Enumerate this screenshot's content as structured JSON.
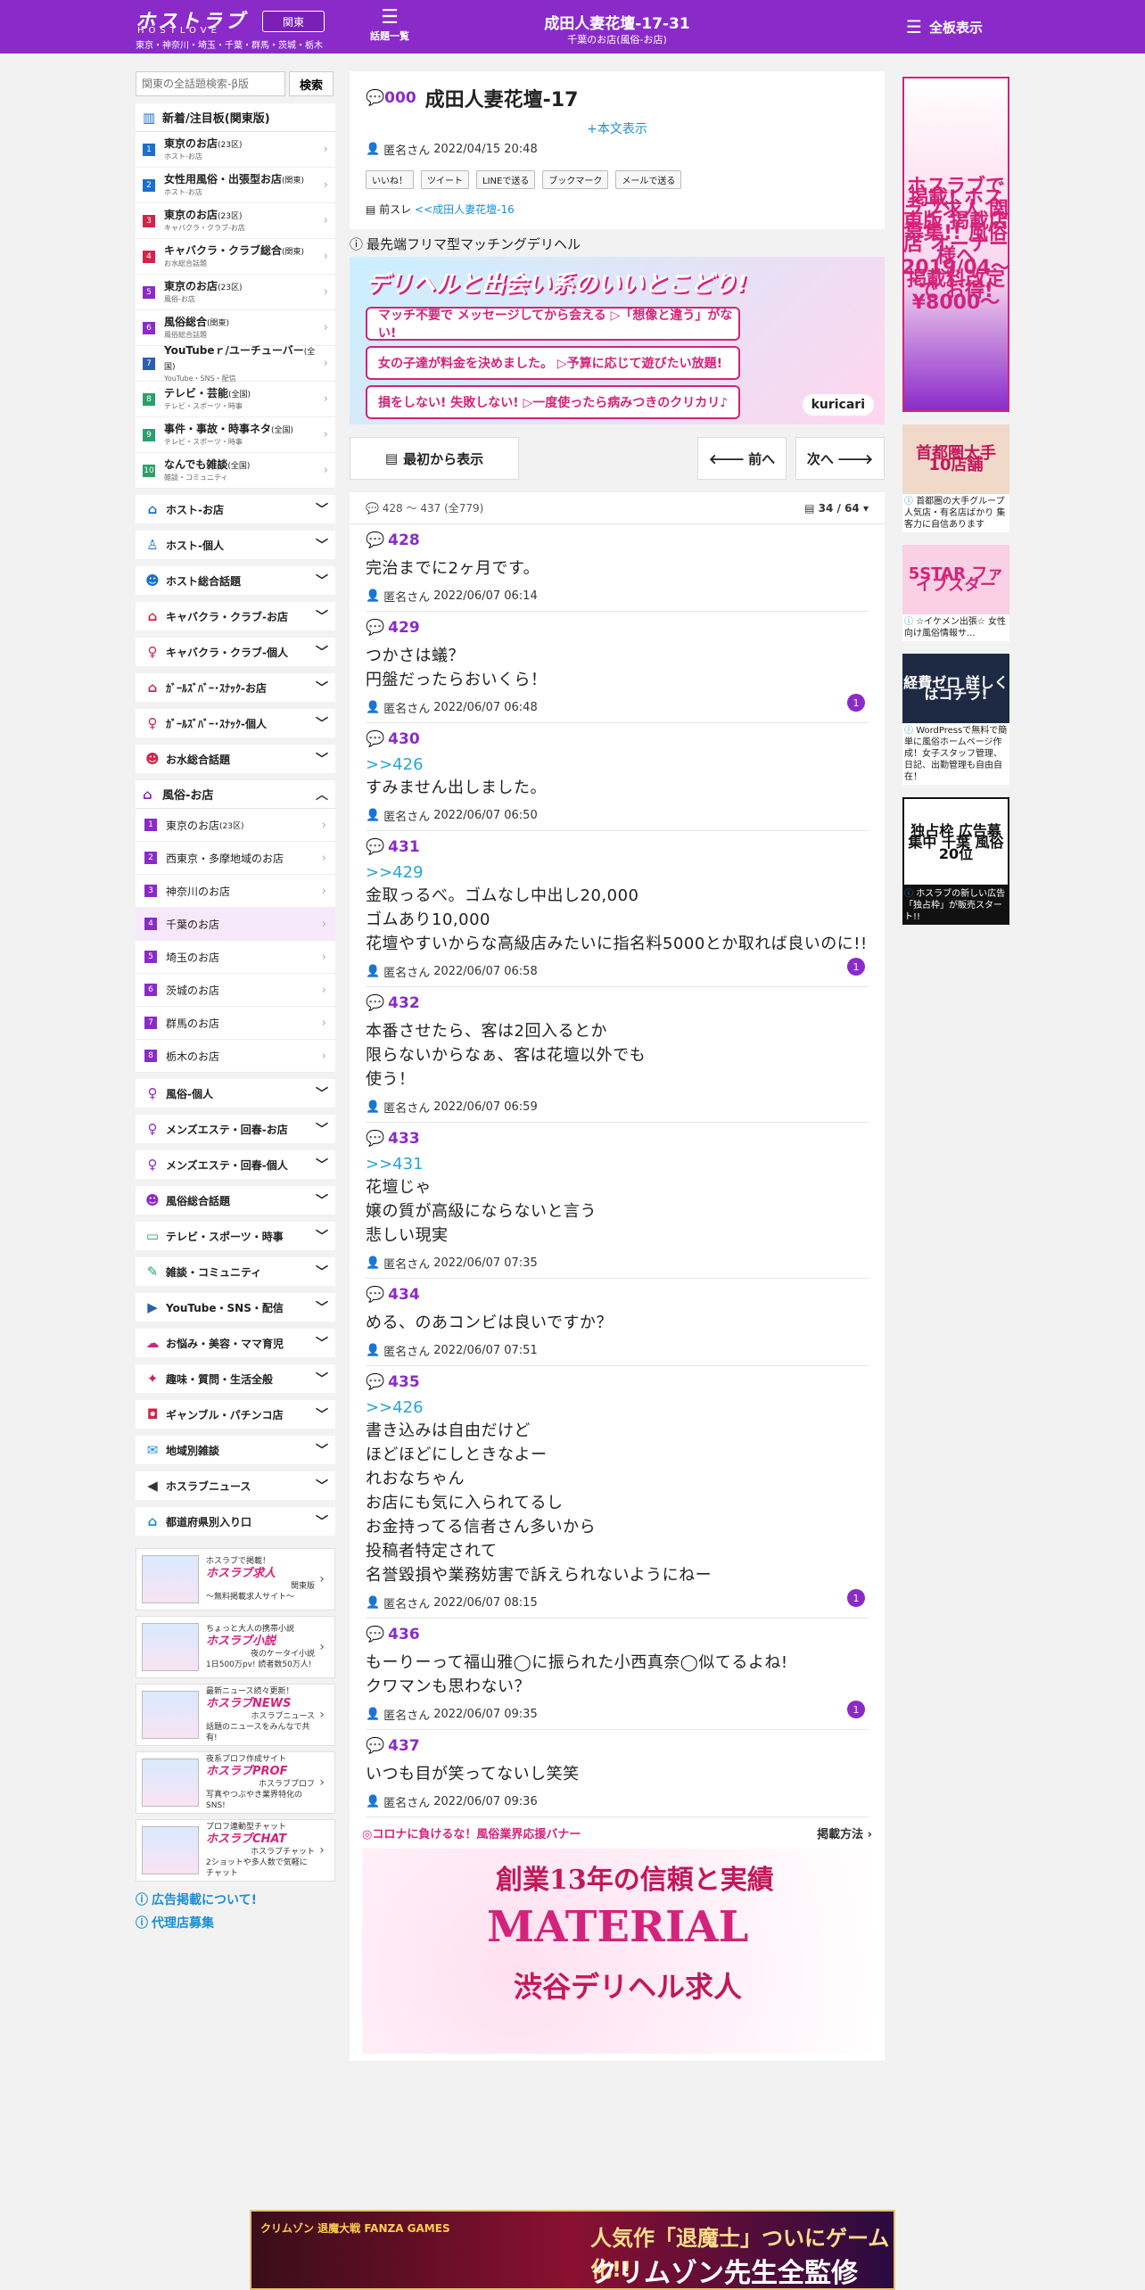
{
  "header": {
    "logo": "ホストラブ",
    "logo_sub": "HOSTLOVE",
    "region_button": "関東",
    "region_list": "東京・神奈川・埼玉・千葉・群馬・茨城・栃木",
    "topics_glyph": "☰",
    "topics_label": "話題一覧",
    "title": "成田人妻花壇-17-31",
    "subtitle": "千葉のお店(風俗-お店)",
    "board_label": "全板表示"
  },
  "sidebar": {
    "search_placeholder": "関東の全話題検索-β版",
    "search_button": "検索",
    "new_title": "新着/注目板(関東版)",
    "new_items": [
      {
        "n": "1",
        "color": "#1a6fd0",
        "title": "東京のお店",
        "tag": "(23区)",
        "sub": "ホスト-お店"
      },
      {
        "n": "2",
        "color": "#1a6fd0",
        "title": "女性用風俗・出張型お店",
        "tag": "(関東)",
        "sub": "ホスト-お店"
      },
      {
        "n": "3",
        "color": "#d4234a",
        "title": "東京のお店",
        "tag": "(23区)",
        "sub": "キャバクラ・クラブ-お店"
      },
      {
        "n": "4",
        "color": "#d4234a",
        "title": "キャバクラ・クラブ総合",
        "tag": "(関東)",
        "sub": "お水総合話題"
      },
      {
        "n": "5",
        "color": "#8a2bc9",
        "title": "東京のお店",
        "tag": "(23区)",
        "sub": "風俗-お店"
      },
      {
        "n": "6",
        "color": "#8a2bc9",
        "title": "風俗総合",
        "tag": "(関東)",
        "sub": "風俗総合話題"
      },
      {
        "n": "7",
        "color": "#2a5fb0",
        "title": "YouTubeｒ/ユーチューバー",
        "tag": "(全国)",
        "sub": "YouTube・SNS・配信"
      },
      {
        "n": "8",
        "color": "#2aa06a",
        "title": "テレビ・芸能",
        "tag": "(全国)",
        "sub": "テレビ・スポーツ・時事"
      },
      {
        "n": "9",
        "color": "#2aa06a",
        "title": "事件・事故・時事ネタ",
        "tag": "(全国)",
        "sub": "テレビ・スポーツ・時事"
      },
      {
        "n": "10",
        "color": "#2aa06a",
        "title": "なんでも雑談",
        "tag": "(全国)",
        "sub": "雑談・コミュニティ"
      }
    ],
    "cats_top": [
      {
        "icon": "⌂",
        "color": "#1a6fd0",
        "label": "ホスト-お店",
        "name": "home-icon"
      },
      {
        "icon": "♙",
        "color": "#1a6fd0",
        "label": "ホスト-個人",
        "name": "person-icon"
      },
      {
        "icon": "☻",
        "color": "#1a6fd0",
        "label": "ホスト総合話題",
        "name": "group-icon"
      },
      {
        "icon": "⌂",
        "color": "#d4234a",
        "label": "キャバクラ・クラブ-お店",
        "name": "home-icon"
      },
      {
        "icon": "♀",
        "color": "#d4234a",
        "label": "キャバクラ・クラブ-個人",
        "name": "person-icon"
      },
      {
        "icon": "⌂",
        "color": "#d4234a",
        "label": "ｶﾞｰﾙｽﾞﾊﾞｰ･ｽﾅｯｸ-お店",
        "name": "home-icon"
      },
      {
        "icon": "♀",
        "color": "#d4234a",
        "label": "ｶﾞｰﾙｽﾞﾊﾞｰ･ｽﾅｯｸ-個人",
        "name": "person-icon"
      },
      {
        "icon": "☻",
        "color": "#d4234a",
        "label": "お水総合話題",
        "name": "group-icon"
      }
    ],
    "fuzoku_head": "風俗-お店",
    "fuzoku_items": [
      {
        "n": "1",
        "label": "東京のお店",
        "tag": "(23区)"
      },
      {
        "n": "2",
        "label": "西東京・多摩地域のお店",
        "tag": ""
      },
      {
        "n": "3",
        "label": "神奈川のお店",
        "tag": ""
      },
      {
        "n": "4",
        "label": "千葉のお店",
        "tag": ""
      },
      {
        "n": "5",
        "label": "埼玉のお店",
        "tag": ""
      },
      {
        "n": "6",
        "label": "茨城のお店",
        "tag": ""
      },
      {
        "n": "7",
        "label": "群馬のお店",
        "tag": ""
      },
      {
        "n": "8",
        "label": "栃木のお店",
        "tag": ""
      }
    ],
    "cats_bottom": [
      {
        "icon": "♀",
        "color": "#8a2bc9",
        "label": "風俗-個人",
        "name": "person-icon"
      },
      {
        "icon": "♀",
        "color": "#8a2bc9",
        "label": "メンズエステ・回春-お店",
        "name": "person-icon"
      },
      {
        "icon": "♀",
        "color": "#8a2bc9",
        "label": "メンズエステ・回春-個人",
        "name": "person-icon"
      },
      {
        "icon": "☻",
        "color": "#8a2bc9",
        "label": "風俗総合話題",
        "name": "group-icon"
      },
      {
        "icon": "▭",
        "color": "#2aa06a",
        "label": "テレビ・スポーツ・時事",
        "name": "tv-icon"
      },
      {
        "icon": "✎",
        "color": "#2aa06a",
        "label": "雑談・コミュニティ",
        "name": "chat-icon"
      },
      {
        "icon": "▶",
        "color": "#2a5fb0",
        "label": "YouTube・SNS・配信",
        "name": "youtube-icon"
      },
      {
        "icon": "☁",
        "color": "#d4237a",
        "label": "お悩み・美容・ママ育児",
        "name": "cloud-icon"
      },
      {
        "icon": "✦",
        "color": "#d4234a",
        "label": "趣味・質問・生活全般",
        "name": "hobby-icon"
      },
      {
        "icon": "◘",
        "color": "#d4234a",
        "label": "ギャンブル・パチンコ店",
        "name": "gamble-icon"
      },
      {
        "icon": "✉",
        "color": "#1a8fd6",
        "label": "地域別雑談",
        "name": "bubble-icon"
      },
      {
        "icon": "◀",
        "color": "#333333",
        "label": "ホスラブニュース",
        "name": "speaker-icon"
      },
      {
        "icon": "⌂",
        "color": "#1a8fd6",
        "label": "都道府県別入り口",
        "name": "home-icon"
      }
    ],
    "promos": [
      {
        "brand": "ホスラブ求人",
        "line1": "ホスラブで掲載！",
        "line2": "関東版",
        "line3": "〜無料掲載求人サイト〜"
      },
      {
        "brand": "ホスラブ小説",
        "line1": "ちょっと大人の携帯小説",
        "line2": "夜のケータイ小説",
        "line3": "1日500万pv! 読者数50万人!"
      },
      {
        "brand": "ホスラブNEWS",
        "line1": "最新ニュース続々更新！",
        "line2": "ホスラブニュース",
        "line3": "話題のニュースをみんなで共有!"
      },
      {
        "brand": "ホスラブPROF",
        "line1": "夜系プロフ作成サイト",
        "line2": "ホスラブプロフ",
        "line3": "写真やつぶやき業界特化のSNS!"
      },
      {
        "brand": "ホスラブCHAT",
        "line1": "プロフ連動型チャット",
        "line2": "ホスラブチャット",
        "line3": "2ショットや多人数で気軽にチャット"
      }
    ],
    "link_ad": "広告掲載について!",
    "link_agency": "代理店募集"
  },
  "thread": {
    "num": "000",
    "title": "成田人妻花壇-17",
    "more": "+本文表示",
    "author": "匿名さん",
    "date": "2022/04/15 20:48",
    "share": [
      "いいね！",
      "ツイート",
      "LINEで送る",
      "ブックマーク",
      "メールで送る"
    ],
    "prev_label": "前スレ",
    "prev_link": "<<成田人妻花壇-16"
  },
  "ad": {
    "label": "最先端フリマ型マッチングデリヘル",
    "headline": "デリヘルと出会い系のいいとこどり!",
    "row1": "マッチ不要で メッセージしてから会える ▷「想像と違う」がない!",
    "row2": "女の子達が料金を決めました。 ▷予算に応じて遊びたい放題!",
    "row3": "損をしない! 失敗しない! ▷一度使ったら病みつきのクリカリ♪",
    "brand": "kuricari"
  },
  "pager": {
    "first": "最初から表示",
    "prev": "前へ",
    "next": "次へ",
    "range": "428 ～ 437",
    "total": "(全779)",
    "page": "34 / 64"
  },
  "posts": [
    {
      "num": "428",
      "anchor": "",
      "body": "完治までに2ヶ月です。",
      "author": "匿名さん",
      "date": "2022/06/07 06:14",
      "badge": ""
    },
    {
      "num": "429",
      "anchor": "",
      "body": "つかさは蟻？\n円盤だったらおいくら！",
      "author": "匿名さん",
      "date": "2022/06/07 06:48",
      "badge": "1"
    },
    {
      "num": "430",
      "anchor": ">>426",
      "body": "すみません出しました。",
      "author": "匿名さん",
      "date": "2022/06/07 06:50",
      "badge": ""
    },
    {
      "num": "431",
      "anchor": ">>429",
      "body": "金取っるべ。ゴムなし中出し20,000\nゴムあり10,000\n花壇やすいからな高級店みたいに指名料5000とか取れば良いのに!!",
      "author": "匿名さん",
      "date": "2022/06/07 06:58",
      "badge": "1"
    },
    {
      "num": "432",
      "anchor": "",
      "body": "本番させたら、客は2回入るとか\n限らないからなぁ、客は花壇以外でも\n使う！",
      "author": "匿名さん",
      "date": "2022/06/07 06:59",
      "badge": ""
    },
    {
      "num": "433",
      "anchor": ">>431",
      "body": "花壇じゃ\n嬢の質が高級にならないと言う\n悲しい現実",
      "author": "匿名さん",
      "date": "2022/06/07 07:35",
      "badge": ""
    },
    {
      "num": "434",
      "anchor": "",
      "body": "める、のあコンビは良いですか？",
      "author": "匿名さん",
      "date": "2022/06/07 07:51",
      "badge": ""
    },
    {
      "num": "435",
      "anchor": ">>426",
      "body": "書き込みは自由だけど\nほどほどにしときなよー\nれおなちゃん\nお店にも気に入られてるし\nお金持ってる信者さん多いから\n投稿者特定されて\n名誉毀損や業務妨害で訴えられないようにねー",
      "author": "匿名さん",
      "date": "2022/06/07 08:15",
      "badge": "1"
    },
    {
      "num": "436",
      "anchor": "",
      "body": "もーりーって福山雅◯に振られた小西真奈◯似てるよね!\nクワマンも思わない？",
      "author": "匿名さん",
      "date": "2022/06/07 09:35",
      "badge": "1"
    },
    {
      "num": "437",
      "anchor": "",
      "body": "いつも目が笑ってないし笑笑",
      "author": "匿名さん",
      "date": "2022/06/07 09:36",
      "badge": ""
    }
  ],
  "corona": {
    "title": "◎コロナに負けるな！風俗業界応援バナー",
    "link": "掲載方法 ›",
    "line1": "創業13年の信頼と実績",
    "line2": "MATERIAL",
    "line3": "渋谷デリヘル求人"
  },
  "right_ads": [
    {
      "img": "ホスラブで掲載! ホスラブ求人 関東版 掲載店 募集!! 風俗店 オーナー様へ 2019/04〜 掲載料改定で お得!¥8000〜",
      "caption": ""
    },
    {
      "img": "首都圏大手 10店舗",
      "caption": "首都圏の大手グループ 人気店・有名店ばかり 集客力に自信あります"
    },
    {
      "img": "5STAR ファイブスター",
      "caption": "☆イケメン出張☆ 女性向け風俗情報サ..."
    },
    {
      "img": "経費ゼロ 詳しくはコチラ!",
      "caption": "WordPressで無料で簡単に風俗ホームページ作成！女子スタッフ管理、日記、出勤管理も自由自在！"
    },
    {
      "img": "独占枠 広告募集中 千葉 風俗 20位",
      "caption": "ホスラブの新しい広告「独占枠」が販売スタート!!"
    }
  ],
  "bottom_ad": {
    "left": "クリムゾン 退魔大戦 FANZA GAMES",
    "line1": "人気作「退魔士」ついにゲーム化!!",
    "line2": "クリムゾン先生全監修"
  }
}
